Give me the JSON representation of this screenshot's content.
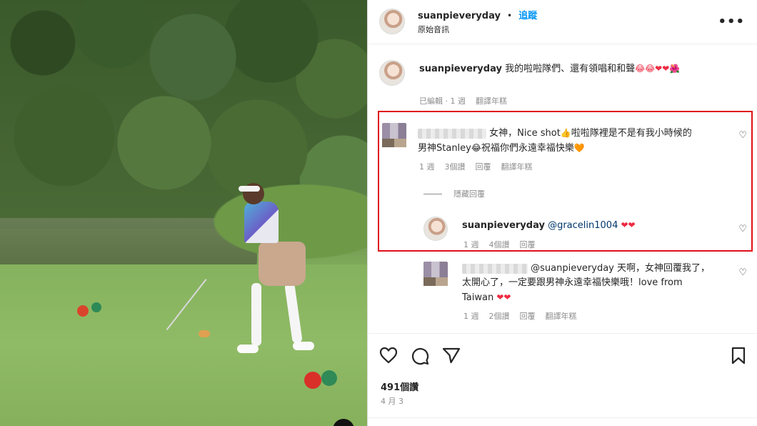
{
  "header": {
    "username": "suanpieveryday",
    "dot": "•",
    "follow_label": "追蹤",
    "subtitle": "原始音訊",
    "more_label": "•••"
  },
  "caption": {
    "username": "suanpieveryday",
    "text": "我的啦啦隊們、還有領唱和和聲",
    "emojis": "😂😂❤❤🌺",
    "emoji_line2": "🌺",
    "meta": {
      "edited": "已編輯 · 1 週",
      "translate": "翻譯年糕"
    }
  },
  "comment1": {
    "text_a": "女神，Nice shot",
    "emoji_a": "👍",
    "text_b": "啦啦隊裡是不是有我小時候的",
    "text_c": "男神Stanley",
    "emoji_b": "😂",
    "text_d": "祝福你們永遠幸福快樂",
    "emoji_c": "🧡",
    "meta": {
      "time": "1 週",
      "likes": "3個讚",
      "reply": "回覆",
      "translate": "翻譯年糕"
    },
    "hide_replies": "隱藏回覆",
    "heart": "♡"
  },
  "reply1": {
    "username": "suanpieveryday",
    "text": "@gracelin1004",
    "emojis": "❤❤",
    "meta": {
      "time": "1 週",
      "likes": "4個讚",
      "reply": "回覆"
    },
    "heart": "♡"
  },
  "reply2": {
    "text_a": "@suanpieveryday 天啊，女神回覆我了，",
    "text_b": "太開心了，一定要跟男神永遠幸福快樂哦！love from",
    "text_c": "Taiwan",
    "emojis": "❤❤",
    "meta": {
      "time": "1 週",
      "likes": "2個讚",
      "reply": "回覆",
      "translate": "翻譯年糕"
    },
    "heart": "♡"
  },
  "actions": {
    "like_icon": "♡",
    "comment_icon": "◯",
    "share_icon": "▷",
    "save_icon": "⚑",
    "likes": "491個讚",
    "date": "4 月 3"
  },
  "colors": {
    "link": "#0095f6",
    "highlight_box": "#e0101c",
    "meta": "#8e8e8e"
  }
}
